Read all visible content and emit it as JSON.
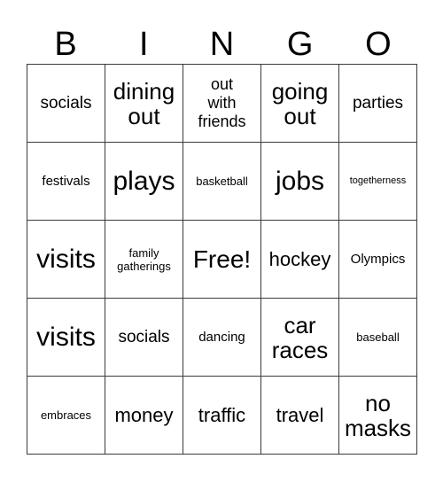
{
  "card": {
    "header_letters": [
      "B",
      "I",
      "N",
      "G",
      "O"
    ],
    "colors": {
      "background": "#ffffff",
      "text": "#000000",
      "grid_line": "#3a3a3a"
    },
    "grid_size": "5x5",
    "free_space_label": "Free!",
    "rows": [
      [
        {
          "text": "socials",
          "size": "fs-sm"
        },
        {
          "text": "dining\nout",
          "size": "fs-lg"
        },
        {
          "text": "out\nwith\nfriends",
          "size": "fs-xs"
        },
        {
          "text": "going\nout",
          "size": "fs-lg"
        },
        {
          "text": "parties",
          "size": "fs-sm"
        }
      ],
      [
        {
          "text": "festivals",
          "size": "fs-xxs"
        },
        {
          "text": "plays",
          "size": "fs-xxl"
        },
        {
          "text": "basketball",
          "size": "fs-tiny"
        },
        {
          "text": "jobs",
          "size": "fs-xxl"
        },
        {
          "text": "togetherness",
          "size": "fs-mini"
        }
      ],
      [
        {
          "text": "visits",
          "size": "fs-xxl"
        },
        {
          "text": "family\ngatherings",
          "size": "fs-tiny"
        },
        {
          "text": "Free!",
          "size": "fs-xl"
        },
        {
          "text": "hockey",
          "size": "fs-md"
        },
        {
          "text": "Olympics",
          "size": "fs-xxs"
        }
      ],
      [
        {
          "text": "visits",
          "size": "fs-xxl"
        },
        {
          "text": "socials",
          "size": "fs-sm"
        },
        {
          "text": "dancing",
          "size": "fs-xxs"
        },
        {
          "text": "car\nraces",
          "size": "fs-lg"
        },
        {
          "text": "baseball",
          "size": "fs-tiny"
        }
      ],
      [
        {
          "text": "embraces",
          "size": "fs-tiny"
        },
        {
          "text": "money",
          "size": "fs-md"
        },
        {
          "text": "traffic",
          "size": "fs-md"
        },
        {
          "text": "travel",
          "size": "fs-md"
        },
        {
          "text": "no\nmasks",
          "size": "fs-lg"
        }
      ]
    ]
  }
}
